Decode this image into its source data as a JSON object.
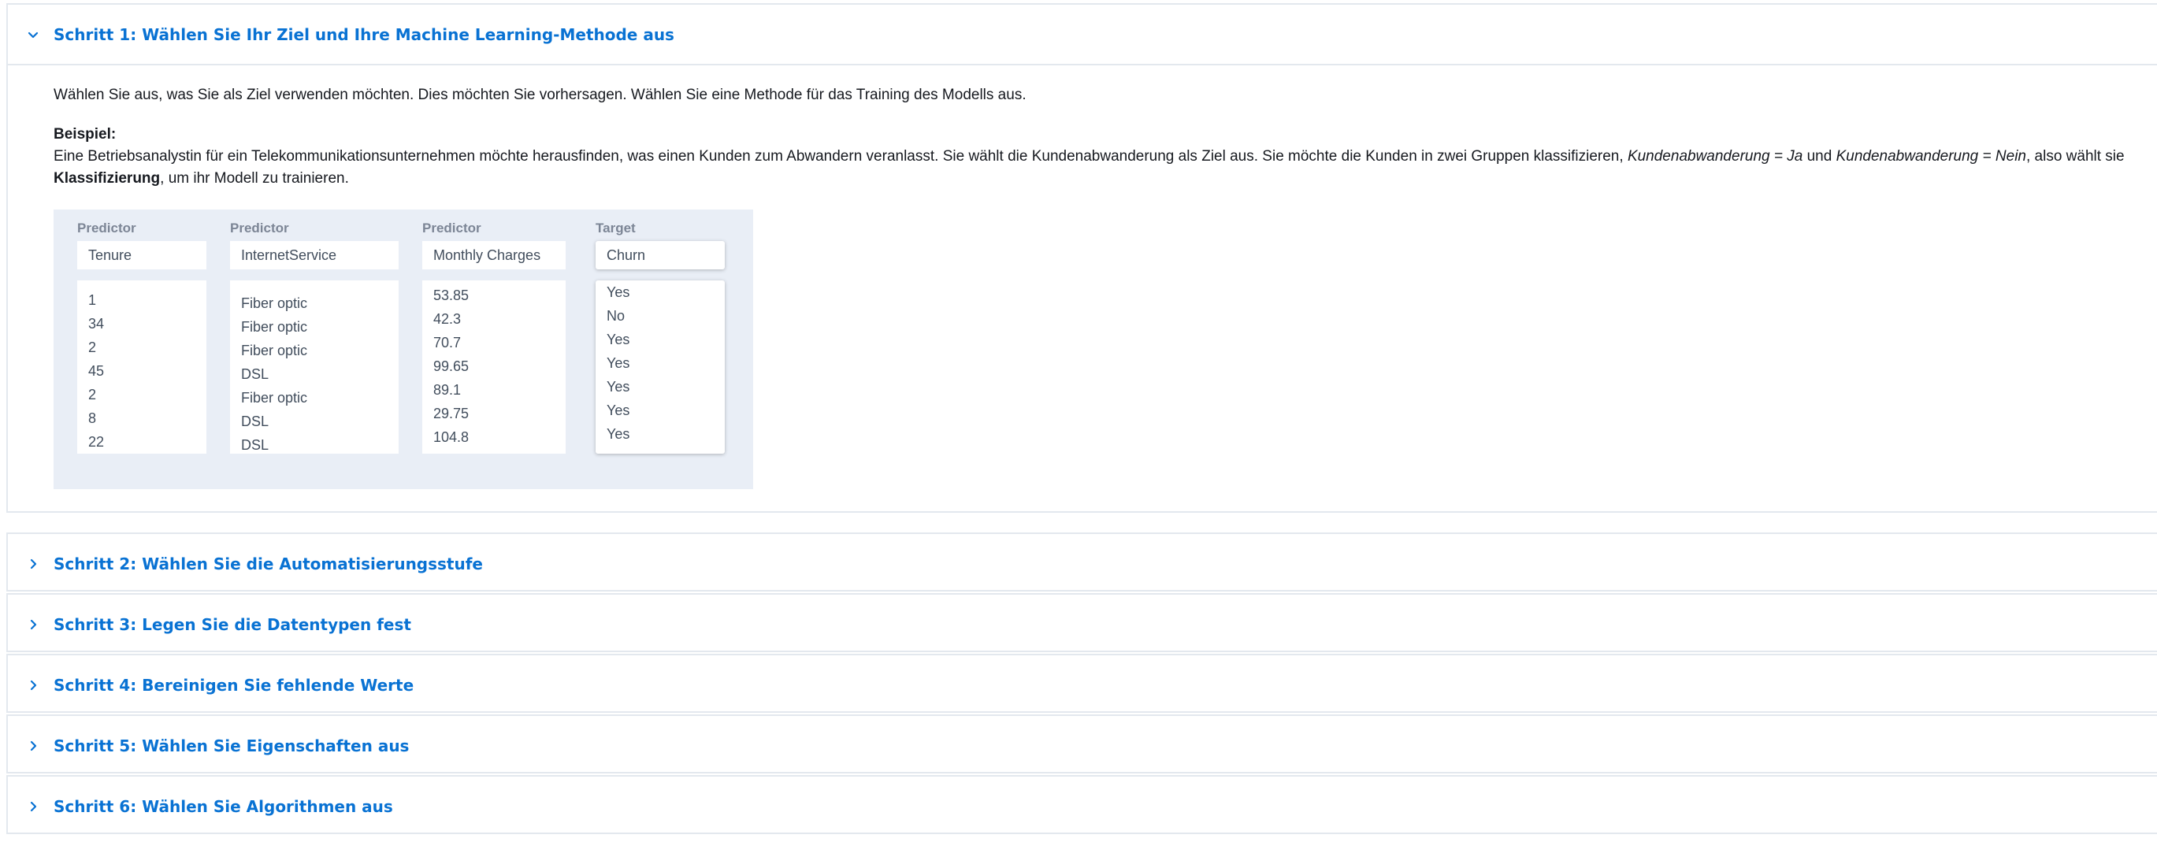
{
  "accent_color": "#0972d3",
  "steps": [
    {
      "title": "Schritt 1: Wählen Sie Ihr Ziel und Ihre Machine Learning-Methode aus",
      "expanded": true,
      "icon": "chevron-down-icon"
    },
    {
      "title": "Schritt 2: Wählen Sie die Automatisierungsstufe",
      "expanded": false,
      "icon": "chevron-right-icon"
    },
    {
      "title": "Schritt 3: Legen Sie die Datentypen fest",
      "expanded": false,
      "icon": "chevron-right-icon"
    },
    {
      "title": "Schritt 4: Bereinigen Sie fehlende Werte",
      "expanded": false,
      "icon": "chevron-right-icon"
    },
    {
      "title": "Schritt 5: Wählen Sie Eigenschaften aus",
      "expanded": false,
      "icon": "chevron-right-icon"
    },
    {
      "title": "Schritt 6: Wählen Sie Algorithmen aus",
      "expanded": false,
      "icon": "chevron-right-icon"
    }
  ],
  "step1": {
    "intro": "Wählen Sie aus, was Sie als Ziel verwenden möchten. Dies möchten Sie vorhersagen. Wählen Sie eine Methode für das Training des Modells aus.",
    "example_label": "Beispiel:",
    "example_part1": "Eine Betriebsanalystin für ein Telekommunikationsunternehmen möchte herausfinden, was einen Kunden zum Abwandern veranlasst. Sie wählt die Kundenabwanderung als Ziel aus. Sie möchte die Kunden in zwei Gruppen klassifizieren, ",
    "example_italic1": "Kundenabwanderung = Ja",
    "example_and": " und ",
    "example_italic2": "Kundenabwanderung = Nein",
    "example_part2": ", also wählt sie ",
    "example_bold": "Klassifizierung",
    "example_part3": ", um ihr Modell zu trainieren."
  },
  "table": {
    "columns": [
      {
        "role": "Predictor",
        "name": "Tenure",
        "values": [
          "1",
          "34",
          "2",
          "45",
          "2",
          "8",
          "22"
        ]
      },
      {
        "role": "Predictor",
        "name": "InternetService",
        "values": [
          "Fiber optic",
          "Fiber optic",
          "Fiber optic",
          "DSL",
          "Fiber optic",
          "DSL",
          "DSL"
        ]
      },
      {
        "role": "Predictor",
        "name": "Monthly Charges",
        "values": [
          "53.85",
          "42.3",
          "70.7",
          "99.65",
          "89.1",
          "29.75",
          "104.8"
        ]
      },
      {
        "role": "Target",
        "name": "Churn",
        "values": [
          "Yes",
          "No",
          "Yes",
          "Yes",
          "Yes",
          "Yes",
          "Yes"
        ]
      }
    ]
  }
}
